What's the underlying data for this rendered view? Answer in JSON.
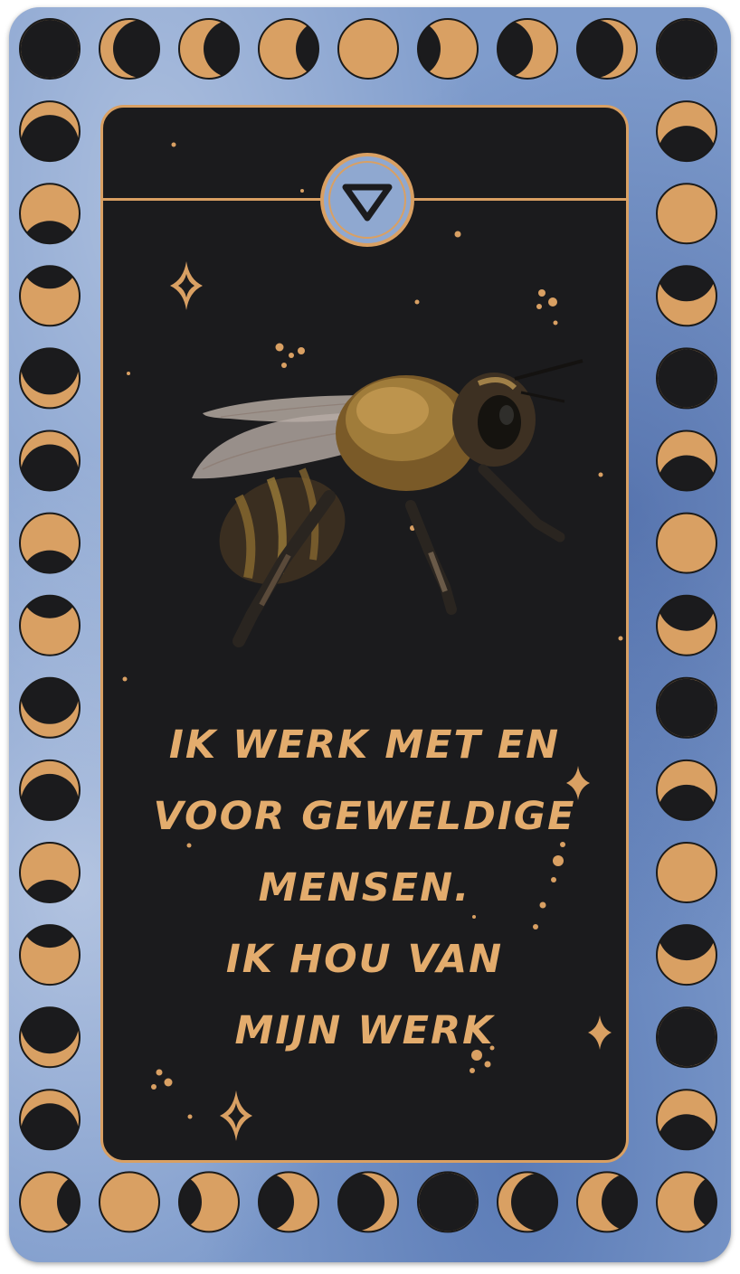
{
  "card": {
    "affirmation_lines": [
      "IK WERK MET EN",
      "VOOR GEWELDIGE",
      "MENSEN.",
      "IK HOU VAN",
      "MIJN WERK"
    ],
    "symbol_icon": "down-triangle-icon",
    "illustration_icon": "bee-icon",
    "colors": {
      "gold": "#d9a063",
      "text_gold": "#e3ac6d",
      "panel": "#1b1b1d",
      "moon_dark": "#1b1b1d",
      "background_blue": "#7f9ccc"
    }
  }
}
